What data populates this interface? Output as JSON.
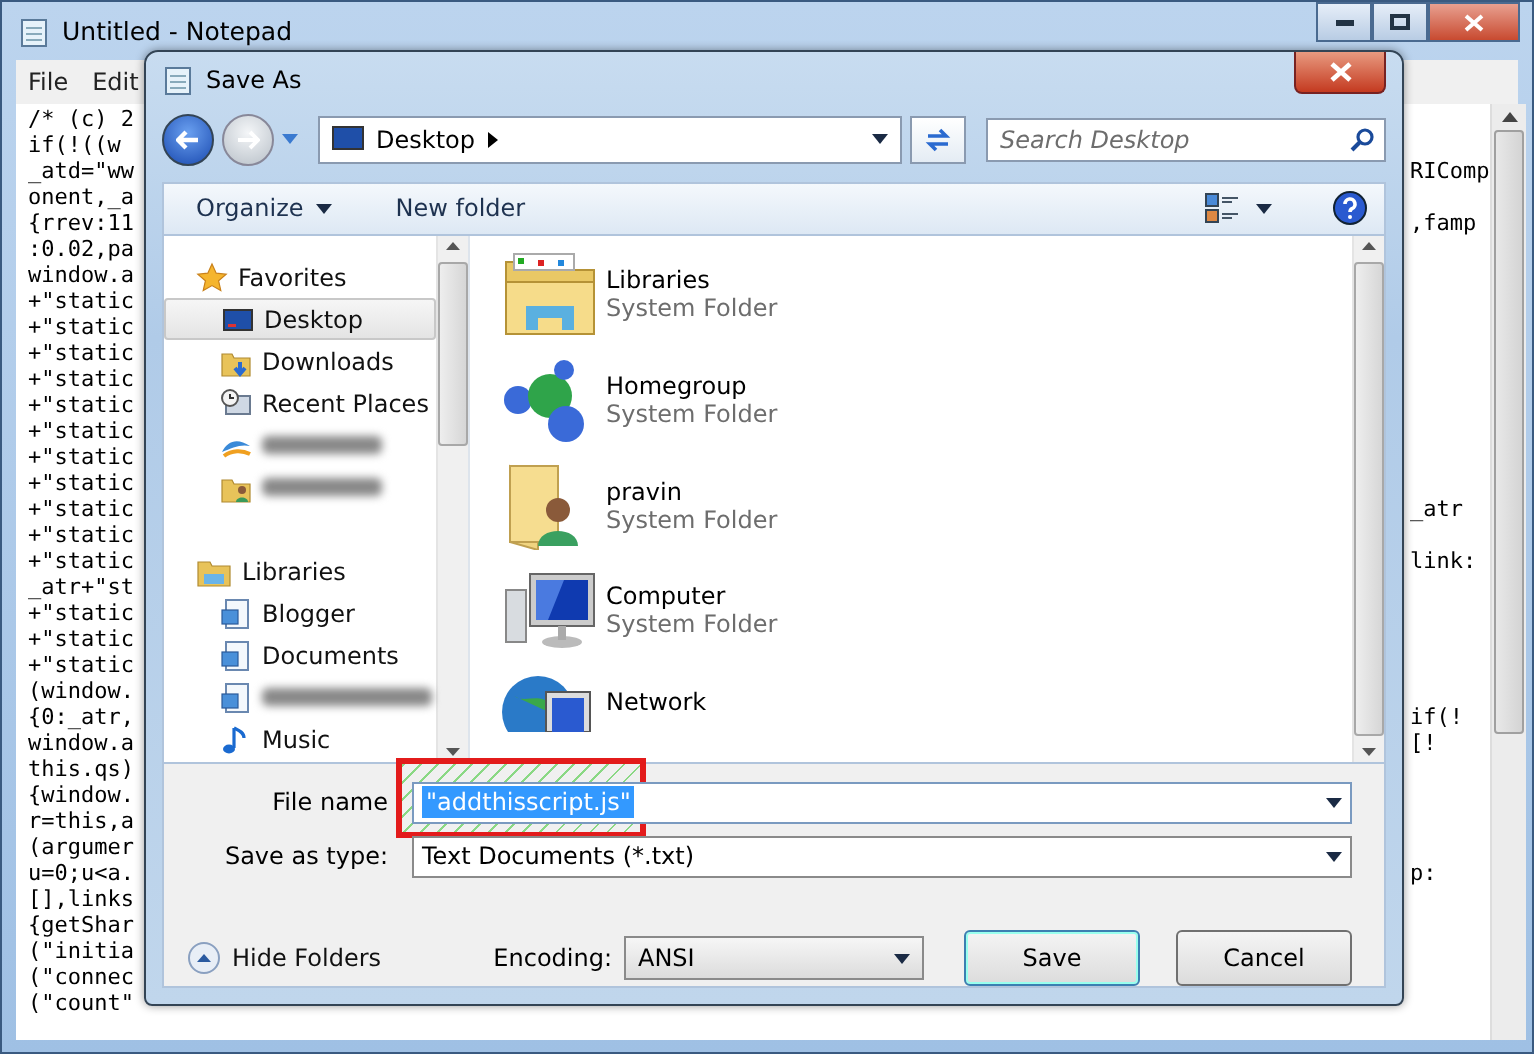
{
  "notepad": {
    "title": "Untitled - Notepad",
    "menu": [
      "File",
      "Edit"
    ],
    "lines": [
      {
        "text": "/* (c) 2"
      },
      {
        "text": "if(!((w"
      },
      {
        "text": "_atd=\"ww",
        "right": "RIComp"
      },
      {
        "text": "onent,_a"
      },
      {
        "text": "{rrev:11",
        "right": ",famp"
      },
      {
        "text": ":0.02,pa"
      },
      {
        "text": "window.a"
      },
      {
        "text": "+\"static"
      },
      {
        "text": "+\"static"
      },
      {
        "text": "+\"static"
      },
      {
        "text": "+\"static"
      },
      {
        "text": "+\"static"
      },
      {
        "text": "+\"static"
      },
      {
        "text": "+\"static"
      },
      {
        "text": "+\"static"
      },
      {
        "text": "+\"static",
        "right": "_atr"
      },
      {
        "text": "+\"static"
      },
      {
        "text": "+\"static",
        "right": "link:"
      },
      {
        "text": "_atr+\"st"
      },
      {
        "text": "+\"static"
      },
      {
        "text": "+\"static"
      },
      {
        "text": "+\"static"
      },
      {
        "text": "(window."
      },
      {
        "text": "{0:_atr,",
        "right": "if(!"
      },
      {
        "text": "window.a",
        "right": "[!"
      },
      {
        "text": "this.qs)"
      },
      {
        "text": "{window."
      },
      {
        "text": "r=this,a"
      },
      {
        "text": "(argumer"
      },
      {
        "text": "u=0;u<a.",
        "right": "p:"
      },
      {
        "text": "[],links"
      },
      {
        "text": "{getShar"
      },
      {
        "text": "(\"initia"
      },
      {
        "text": "(\"connec"
      },
      {
        "text": "(\"count\""
      }
    ]
  },
  "dialog": {
    "title": "Save As",
    "location": "Desktop",
    "search": {
      "placeholder": "Search Desktop"
    },
    "toolbar": [
      {
        "label": "Organize",
        "kind": "menu"
      },
      {
        "label": "New folder",
        "kind": "button"
      }
    ],
    "nav": [
      {
        "kind": "header",
        "label": "Favorites",
        "selected": false
      },
      {
        "kind": "item",
        "label": "Desktop",
        "selected": true
      },
      {
        "kind": "item",
        "label": "Downloads",
        "selected": false
      },
      {
        "kind": "item",
        "label": "Recent Places",
        "selected": false
      },
      {
        "kind": "blurred",
        "selected": false
      },
      {
        "kind": "blurred",
        "selected": false
      },
      {
        "kind": "header",
        "label": "Libraries",
        "selected": false
      },
      {
        "kind": "item",
        "label": "Blogger",
        "selected": false
      },
      {
        "kind": "item",
        "label": "Documents",
        "selected": false
      },
      {
        "kind": "blurred",
        "selected": false
      },
      {
        "kind": "item",
        "label": "Music",
        "selected": false
      }
    ],
    "files": [
      {
        "name": "Libraries",
        "type": "System Folder"
      },
      {
        "name": "Homegroup",
        "type": "System Folder"
      },
      {
        "name": "pravin",
        "type": "System Folder"
      },
      {
        "name": "Computer",
        "type": "System Folder"
      },
      {
        "name": "Network"
      }
    ],
    "file_name": {
      "label": "File name",
      "value": "\"addthisscript.js\"",
      "text_selected": true,
      "highlighted": true
    },
    "save_as_type": {
      "label": "Save as type:",
      "value": "Text Documents (*.txt)"
    },
    "hide_folders": "Hide Folders",
    "encoding": {
      "label": "Encoding:",
      "value": "ANSI"
    },
    "buttons": [
      {
        "label": "Save",
        "kind": "default"
      },
      {
        "label": "Cancel",
        "kind": "normal"
      }
    ]
  }
}
